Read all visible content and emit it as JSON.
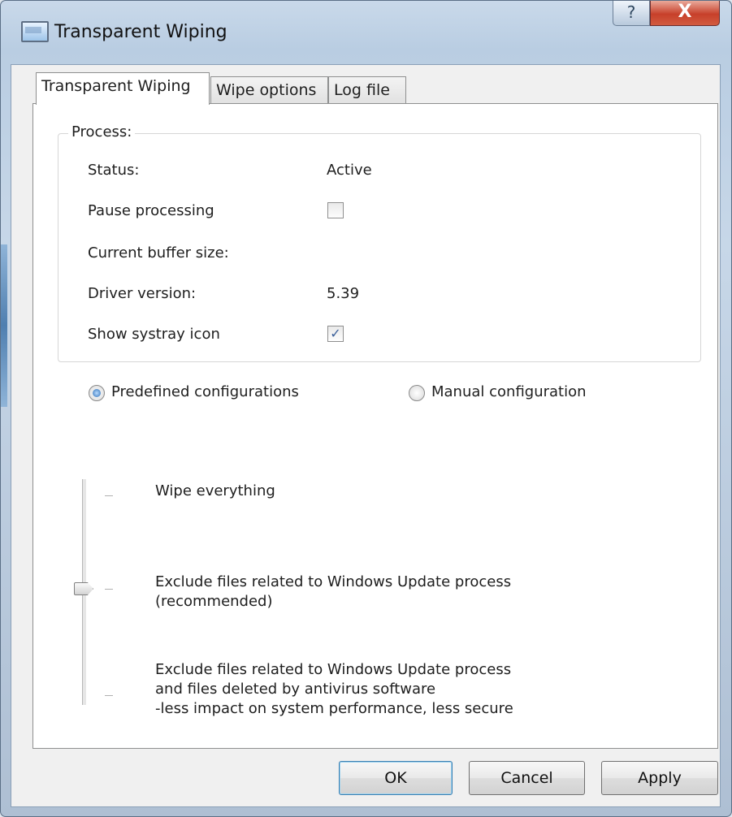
{
  "window": {
    "title": "Transparent Wiping",
    "help_glyph": "?",
    "close_glyph": "X"
  },
  "tabs": [
    {
      "label": "Transparent Wiping",
      "active": true
    },
    {
      "label": "Wipe options",
      "active": false
    },
    {
      "label": "Log file",
      "active": false
    }
  ],
  "process": {
    "group_label": "Process:",
    "status_label": "Status:",
    "status_value": "Active",
    "pause_label": "Pause processing",
    "pause_checked": false,
    "buffer_label": "Current buffer size:",
    "buffer_value": "",
    "driver_label": "Driver version:",
    "driver_value": "5.39",
    "systray_label": "Show systray icon",
    "systray_checked": true
  },
  "configuration": {
    "predefined_label": "Predefined configurations",
    "manual_label": "Manual configuration",
    "selected": "predefined"
  },
  "slider": {
    "levels": [
      "Wipe everything",
      "Exclude files related to Windows Update process\n(recommended)",
      "Exclude files related to Windows Update process\nand files deleted by antivirus software\n-less impact on system performance, less secure"
    ],
    "selected_index": 1
  },
  "buttons": {
    "ok": "OK",
    "cancel": "Cancel",
    "apply": "Apply"
  },
  "colors": {
    "title_gradient_top": "#c9d9ea",
    "close_button": "#c7402a",
    "accent_radio": "#2b6db6"
  }
}
